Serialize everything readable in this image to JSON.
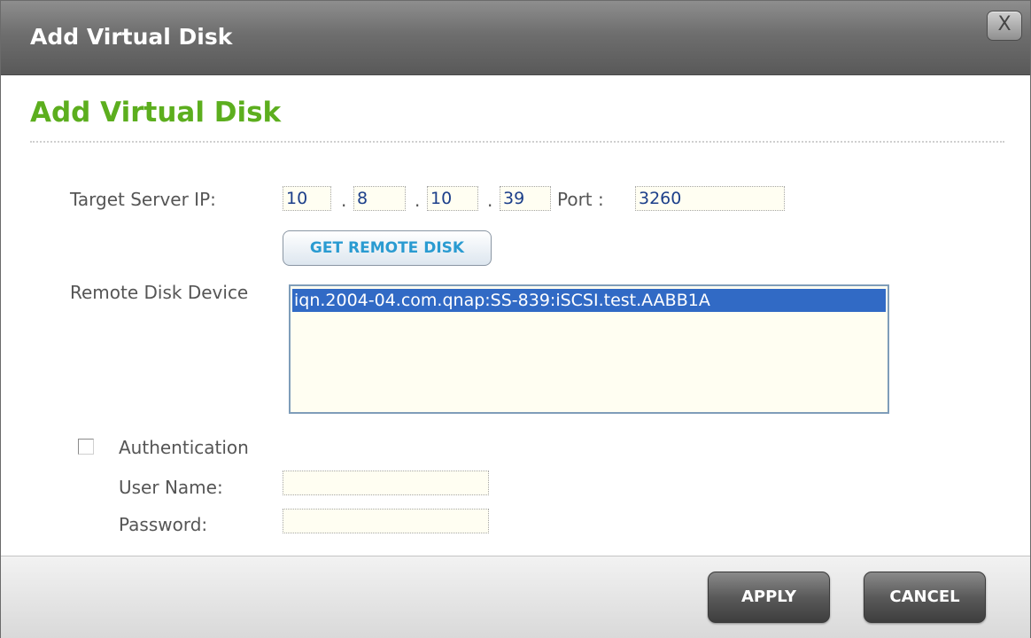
{
  "window": {
    "title": "Add Virtual Disk",
    "close_label": "X"
  },
  "page": {
    "heading": "Add Virtual Disk"
  },
  "target": {
    "label": "Target Server IP:",
    "ip": [
      "10",
      "8",
      "10",
      "39"
    ],
    "separator": ".",
    "port_label": "Port :",
    "port_value": "3260",
    "get_button": "GET REMOTE DISK"
  },
  "remote": {
    "label": "Remote Disk Device",
    "items": [
      "iqn.2004-04.com.qnap:SS-839:iSCSI.test.AABB1A"
    ],
    "selected_index": 0
  },
  "auth": {
    "checkbox_label": "Authentication",
    "checked": false,
    "username_label": "User Name:",
    "username_value": "",
    "password_label": "Password:",
    "password_value": ""
  },
  "footer": {
    "apply": "APPLY",
    "cancel": "CANCEL"
  },
  "colors": {
    "heading_green": "#5cae1e",
    "selection_blue": "#316ac5",
    "field_bg": "#fffef2"
  }
}
